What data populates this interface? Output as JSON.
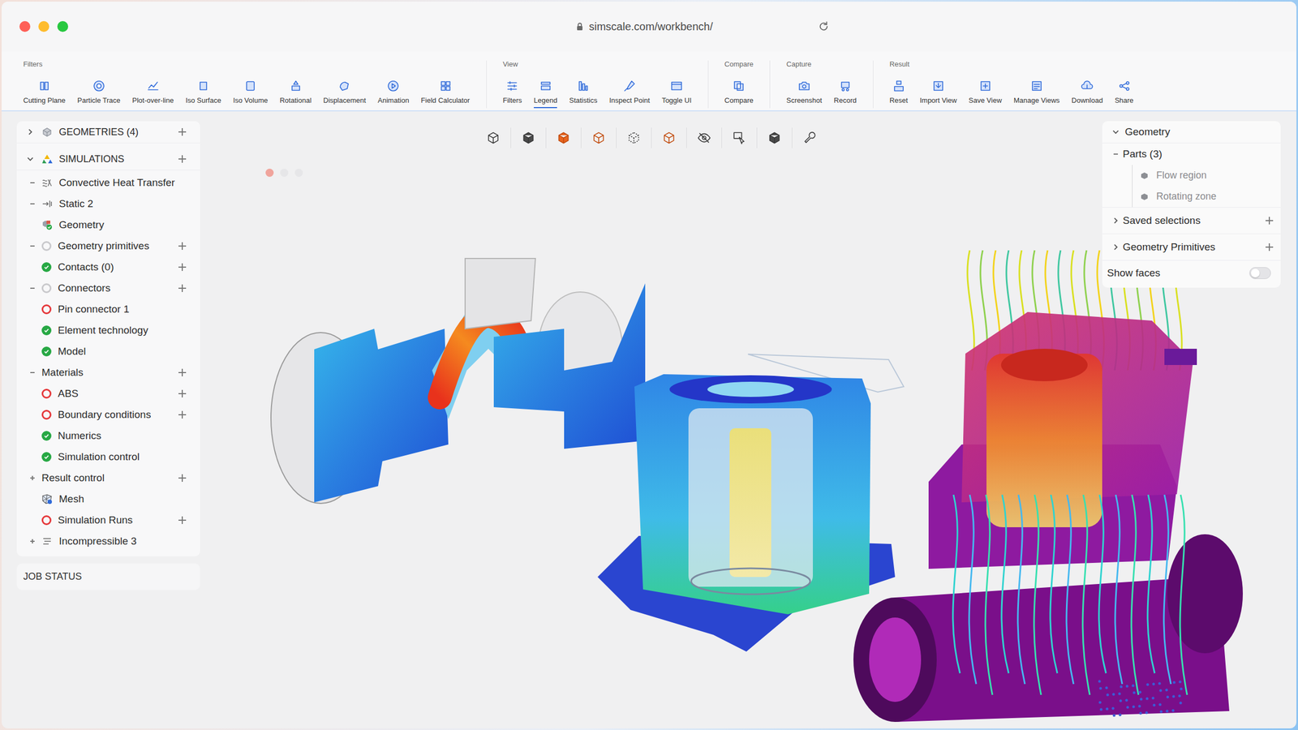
{
  "window": {
    "url": "simscale.com/workbench/"
  },
  "toolbar": {
    "groups": [
      {
        "label": "Filters",
        "tools": [
          {
            "label": "Cutting Plane",
            "selected": false
          },
          {
            "label": "Particle Trace",
            "selected": false
          },
          {
            "label": "Plot-over-line",
            "selected": false
          },
          {
            "label": "Iso Surface",
            "selected": false
          },
          {
            "label": "Iso Volume",
            "selected": false
          },
          {
            "label": "Rotational",
            "selected": false
          },
          {
            "label": "Displacement",
            "selected": false
          },
          {
            "label": "Animation",
            "selected": false
          },
          {
            "label": "Field Calculator",
            "selected": false
          }
        ]
      },
      {
        "label": "View",
        "tools": [
          {
            "label": "Filters",
            "selected": false
          },
          {
            "label": "Legend",
            "selected": true
          },
          {
            "label": "Statistics",
            "selected": false
          },
          {
            "label": "Inspect Point",
            "selected": false
          },
          {
            "label": "Toggle UI",
            "selected": false
          }
        ]
      },
      {
        "label": "Compare",
        "tools": [
          {
            "label": "Compare",
            "selected": false
          }
        ]
      },
      {
        "label": "Capture",
        "tools": [
          {
            "label": "Screenshot",
            "selected": false
          },
          {
            "label": "Record",
            "selected": false
          }
        ]
      },
      {
        "label": "Result",
        "tools": [
          {
            "label": "Reset",
            "selected": false
          },
          {
            "label": "Import View",
            "selected": false
          },
          {
            "label": "Save View",
            "selected": false
          },
          {
            "label": "Manage Views",
            "selected": false
          },
          {
            "label": "Download",
            "selected": false
          },
          {
            "label": "Share",
            "selected": false
          }
        ]
      }
    ]
  },
  "sidebar": {
    "sections": [
      {
        "label": "GEOMETRIES (4)",
        "kind": "geometries",
        "expanded": false,
        "addable": true,
        "items": []
      },
      {
        "label": "SIMULATIONS",
        "kind": "simulations",
        "expanded": true,
        "addable": true,
        "items": [
          {
            "label": "Convective Heat Transfer",
            "kind": "thermal",
            "has_children": true,
            "expanded": true,
            "addable": false
          },
          {
            "label": "Static 2",
            "kind": "static",
            "has_children": true,
            "expanded": true,
            "addable": false
          },
          {
            "label": "Geometry",
            "kind": "geometry",
            "has_children": false,
            "expanded": false,
            "addable": false
          },
          {
            "label": "Geometry primitives",
            "kind": "pending",
            "has_children": true,
            "expanded": true,
            "addable": true
          },
          {
            "label": "Contacts (0)",
            "kind": "ok",
            "has_children": false,
            "expanded": false,
            "addable": true
          },
          {
            "label": "Connectors",
            "kind": "pending",
            "has_children": true,
            "expanded": true,
            "addable": true
          },
          {
            "label": "Pin connector 1",
            "kind": "error",
            "has_children": false,
            "expanded": false,
            "addable": false
          },
          {
            "label": "Element technology",
            "kind": "ok",
            "has_children": false,
            "expanded": false,
            "addable": false
          },
          {
            "label": "Model",
            "kind": "ok",
            "has_children": false,
            "expanded": false,
            "addable": false
          },
          {
            "label": "Materials",
            "kind": "none",
            "has_children": true,
            "expanded": true,
            "addable": true
          },
          {
            "label": "ABS",
            "kind": "error",
            "has_children": false,
            "expanded": false,
            "addable": true
          },
          {
            "label": "Boundary conditions",
            "kind": "error",
            "has_children": false,
            "expanded": false,
            "addable": true
          },
          {
            "label": "Numerics",
            "kind": "ok",
            "has_children": false,
            "expanded": false,
            "addable": false
          },
          {
            "label": "Simulation control",
            "kind": "ok",
            "has_children": false,
            "expanded": false,
            "addable": false
          },
          {
            "label": "Result control",
            "kind": "none",
            "has_children": true,
            "expanded": false,
            "addable": true
          },
          {
            "label": "Mesh",
            "kind": "mesh",
            "has_children": false,
            "expanded": false,
            "addable": false
          },
          {
            "label": "Simulation Runs",
            "kind": "error",
            "has_children": false,
            "expanded": false,
            "addable": true
          },
          {
            "label": "Incompressible 3",
            "kind": "list",
            "has_children": true,
            "expanded": false,
            "addable": false
          }
        ]
      }
    ],
    "job_status": "JOB STATUS"
  },
  "viewport": {
    "steps": [
      {
        "selected": true
      },
      {
        "selected": false
      },
      {
        "selected": false
      }
    ],
    "view_tools": [
      {
        "selected": false
      },
      {
        "selected": false
      },
      {
        "selected": true
      },
      {
        "selected": true
      },
      {
        "selected": false
      },
      {
        "selected": true
      },
      {
        "selected": false
      },
      {
        "selected": false
      },
      {
        "selected": false
      },
      {
        "selected": false
      }
    ]
  },
  "geometry_panel": {
    "title": "Geometry",
    "expanded": true,
    "group": {
      "label": "Parts (3)",
      "expanded": true,
      "parts": [
        {
          "label": "Flow region",
          "hidden": true
        },
        {
          "label": "Rotating zone",
          "hidden": true
        }
      ]
    },
    "sections": [
      {
        "label": "Saved selections",
        "expanded": false,
        "addable": true
      },
      {
        "label": "Geometry Primitives",
        "expanded": false,
        "addable": true
      }
    ],
    "show_faces": {
      "label": "Show faces",
      "on": false
    }
  }
}
